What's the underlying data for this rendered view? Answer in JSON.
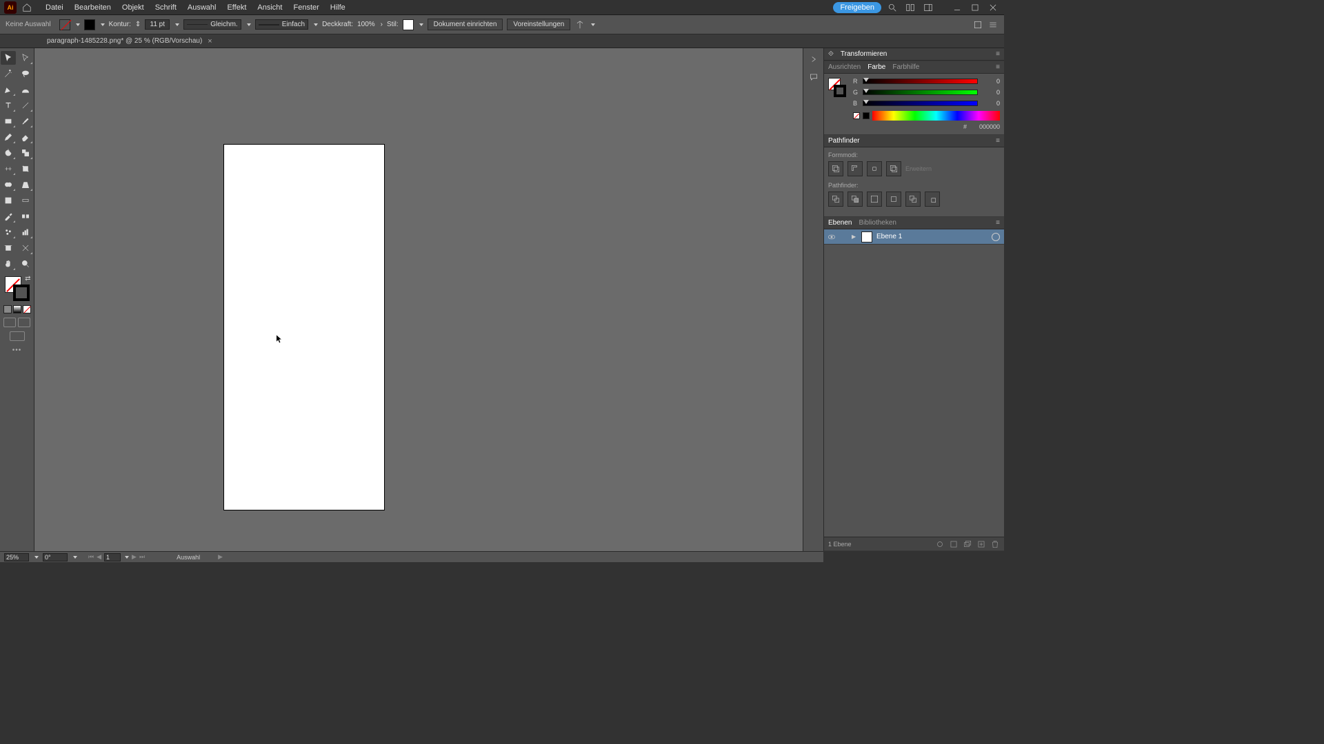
{
  "menu": {
    "items": [
      "Datei",
      "Bearbeiten",
      "Objekt",
      "Schrift",
      "Auswahl",
      "Effekt",
      "Ansicht",
      "Fenster",
      "Hilfe"
    ],
    "share": "Freigeben"
  },
  "options": {
    "selection": "Keine Auswahl",
    "kontur_label": "Kontur:",
    "stroke_width": "11 pt",
    "stroke_profile": "Gleichm.",
    "brush": "Einfach",
    "opacity_label": "Deckkraft:",
    "opacity": "100%",
    "style_label": "Stil:",
    "doc_setup": "Dokument einrichten",
    "prefs": "Voreinstellungen"
  },
  "document": {
    "tab_title": "paragraph-1485228.png* @ 25 % (RGB/Vorschau)"
  },
  "panels": {
    "transform": {
      "title": "Transformieren"
    },
    "color": {
      "tabs": [
        "Ausrichten",
        "Farbe",
        "Farbhilfe"
      ],
      "active": 1,
      "r_label": "R",
      "r_value": "0",
      "g_label": "G",
      "g_value": "0",
      "b_label": "B",
      "b_value": "0",
      "hex_prefix": "#",
      "hex_value": "000000"
    },
    "pathfinder": {
      "title": "Pathfinder",
      "shapemodes_label": "Formmodi:",
      "pathfinders_label": "Pathfinder:",
      "expand": "Erweitern"
    },
    "layers": {
      "tabs": [
        "Ebenen",
        "Bibliotheken"
      ],
      "active": 0,
      "layer_name": "Ebene 1",
      "footer_count": "1 Ebene"
    }
  },
  "status": {
    "zoom": "25%",
    "rotation": "0°",
    "artboard": "1",
    "tool": "Auswahl"
  }
}
